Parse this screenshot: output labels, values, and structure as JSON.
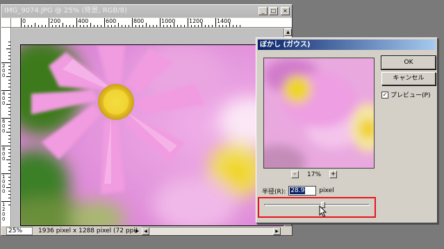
{
  "document": {
    "title": "IMG_9074.JPG @ 25% (背景, RGB/8)",
    "ruler_h_labels": [
      "0",
      "200",
      "400",
      "600",
      "800",
      "1000",
      "1200",
      "1400"
    ],
    "ruler_v_labels": [
      "200",
      "400",
      "600",
      "800",
      "1000",
      "1200"
    ],
    "zoom": "25%",
    "status": "1936 pixel x 1288 pixel (72 ppi)"
  },
  "dialog": {
    "title": "ぼかし (ガウス)",
    "ok_label": "OK",
    "cancel_label": "キャンセル",
    "preview_label": "プレビュー(P)",
    "preview_checked": true,
    "zoom_percent": "17%",
    "zoom_minus": "-",
    "zoom_plus": "+",
    "radius_label": "半径(R):",
    "radius_value": "28.9",
    "radius_unit": "pixel",
    "slider_fraction": 0.56
  },
  "colors": {
    "highlight": "#e8141b",
    "dialog_title": "#0a246a"
  }
}
